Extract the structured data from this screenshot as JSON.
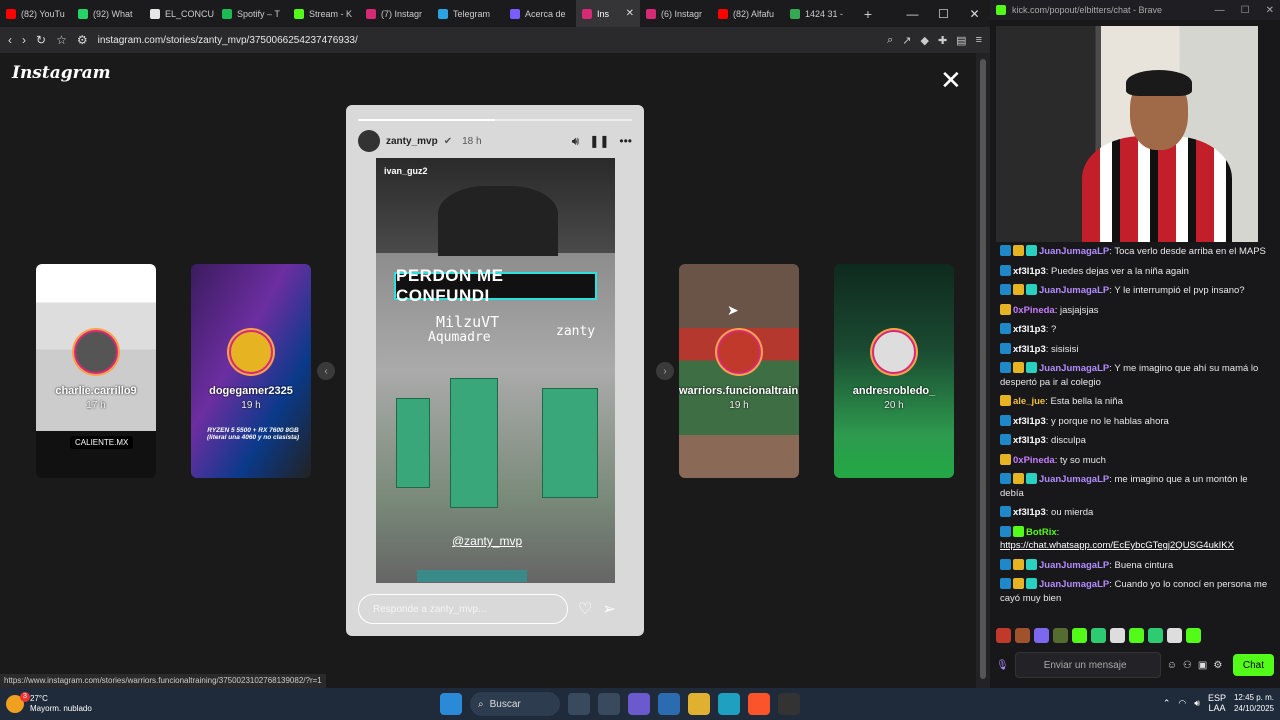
{
  "browser": {
    "tabs": [
      {
        "label": "(82) YouTu",
        "color": "#ff0000"
      },
      {
        "label": "(92) What",
        "color": "#25d366"
      },
      {
        "label": "EL_CONCU",
        "color": "#e6e6e6"
      },
      {
        "label": "Spotify – T",
        "color": "#1db954"
      },
      {
        "label": "Stream - K",
        "color": "#53fc18"
      },
      {
        "label": "(7) Instagr",
        "color": "#d62976"
      },
      {
        "label": "Telegram",
        "color": "#2aa3e0"
      },
      {
        "label": "Acerca de",
        "color": "#7b5cff"
      },
      {
        "label": "Ins",
        "color": "#d62976",
        "active": true
      },
      {
        "label": "(6) Instagr",
        "color": "#d62976"
      },
      {
        "label": "(82) Alfafu",
        "color": "#ff0000"
      },
      {
        "label": "1424 31 -",
        "color": "#34a853"
      }
    ],
    "url": "instagram.com/stories/zanty_mvp/3750066254237476933/",
    "status_url": "https://www.instagram.com/stories/warriors.funcionaltraining/3750023102768139082/?r=1"
  },
  "instagram": {
    "logo": "Instagram",
    "side_stories": [
      {
        "user": "charlie.carrillo9",
        "time": "17 h",
        "tag": "CALIENTE.MX"
      },
      {
        "user": "dogegamer2325",
        "time": "19 h",
        "caption": "RYZEN 5 5500 + RX 7600 8GB (literal una 4060 y no clasista)"
      },
      {
        "user": "warriors.funcionaltraining",
        "time": "19 h"
      },
      {
        "user": "andresrobledo_",
        "time": "20 h"
      }
    ],
    "main_story": {
      "user": "zanty_mvp",
      "time": "18 h",
      "progress": 0.5,
      "inner_user": "ivan_guz2",
      "banner": "PERDON ME CONFUNDI",
      "game_text_1": "MilzuVT",
      "game_text_2": "Aqumadre",
      "game_text_3": "zanty",
      "mention": "@zanty_mvp",
      "reply_placeholder": "Responde a zanty_mvp..."
    }
  },
  "chat": {
    "window_url": "kick.com/popout/elbitters/chat - Brave",
    "messages": [
      {
        "user": "JuanJumagaLP",
        "color": "#b38cff",
        "badges": [
          "blue",
          "gold",
          "teal"
        ],
        "text": "Toca verlo desde arriba en el MAPS"
      },
      {
        "user": "xf3l1p3",
        "color": "#ffffff",
        "badges": [
          "blue"
        ],
        "text": "Puedes dejas ver a la niña again"
      },
      {
        "user": "JuanJumagaLP",
        "color": "#b38cff",
        "badges": [
          "blue",
          "gold",
          "teal"
        ],
        "text": "Y le interrumpió el pvp insano?"
      },
      {
        "user": "0xPineda",
        "color": "#c77dff",
        "badges": [
          "gold"
        ],
        "text": "jasjajsjas"
      },
      {
        "user": "xf3l1p3",
        "color": "#ffffff",
        "badges": [
          "blue"
        ],
        "text": "?"
      },
      {
        "user": "xf3l1p3",
        "color": "#ffffff",
        "badges": [
          "blue"
        ],
        "text": "sisisisi"
      },
      {
        "user": "JuanJumagaLP",
        "color": "#b38cff",
        "badges": [
          "blue",
          "gold",
          "teal"
        ],
        "text": "Y me imagino que ahí su mamá lo despertó pa ir al colegio"
      },
      {
        "user": "ale_jue",
        "color": "#f0c040",
        "badges": [
          "gold"
        ],
        "text": "Esta bella la niña"
      },
      {
        "user": "xf3l1p3",
        "color": "#ffffff",
        "badges": [
          "blue"
        ],
        "text": "y porque no le hablas ahora"
      },
      {
        "user": "xf3l1p3",
        "color": "#ffffff",
        "badges": [
          "blue"
        ],
        "text": "disculpa"
      },
      {
        "user": "0xPineda",
        "color": "#c77dff",
        "badges": [
          "gold"
        ],
        "text": "ty so much"
      },
      {
        "user": "JuanJumagaLP",
        "color": "#b38cff",
        "badges": [
          "blue",
          "gold",
          "teal"
        ],
        "text": "me imagino que a un montón le debía"
      },
      {
        "user": "xf3l1p3",
        "color": "#ffffff",
        "badges": [
          "blue"
        ],
        "text": "ou mierda"
      },
      {
        "user": "BotRix",
        "color": "#53fc18",
        "badges": [
          "blue",
          "green"
        ],
        "text": "",
        "link": "https://chat.whatsapp.com/EcEybcGTegj2QUSG4ukIKX"
      },
      {
        "user": "JuanJumagaLP",
        "color": "#b38cff",
        "badges": [
          "blue",
          "gold",
          "teal"
        ],
        "text": "Buena cintura"
      },
      {
        "user": "JuanJumagaLP",
        "color": "#b38cff",
        "badges": [
          "blue",
          "gold",
          "teal"
        ],
        "text": "Cuando yo lo conocí en persona me cayó muy bien"
      }
    ],
    "input_placeholder": "Enviar un mensaje",
    "send_label": "Chat"
  },
  "taskbar": {
    "weather_temp": "27°C",
    "weather_desc": "Mayorm. nublado",
    "search_label": "Buscar",
    "lang_1": "ESP",
    "lang_2": "LAA",
    "time": "12:45 p. m.",
    "date": "24/10/2025",
    "notification_count": "3"
  }
}
